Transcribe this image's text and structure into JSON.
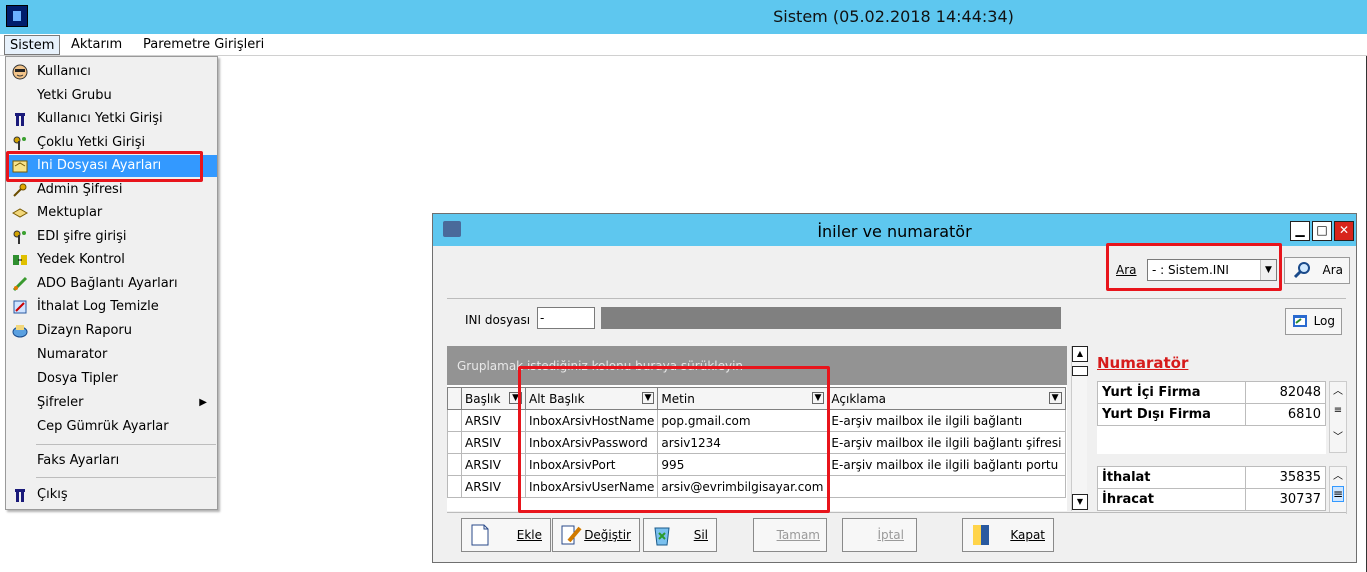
{
  "app": {
    "title": "Sistem (05.02.2018 14:44:34)"
  },
  "menubar": {
    "items": [
      "Sistem",
      "Aktarım",
      "Paremetre Girişleri"
    ]
  },
  "sistem_menu": {
    "items": [
      {
        "label": "Kullanıcı",
        "icon": "user-face-icon"
      },
      {
        "label": "Yetki Grubu",
        "icon": ""
      },
      {
        "label": "Kullanıcı Yetki Girişi",
        "icon": "user-key-icon"
      },
      {
        "label": "Çoklu Yetki Girişi",
        "icon": "keys-icon"
      },
      {
        "label": "Ini Dosyası  Ayarları",
        "icon": "settings-file-icon",
        "selected": true
      },
      {
        "label": "Admin Şifresi",
        "icon": "key-icon"
      },
      {
        "label": "Mektuplar",
        "icon": "envelope-icon"
      },
      {
        "label": "EDI şifre girişi",
        "icon": "keys-icon"
      },
      {
        "label": "Yedek Kontrol",
        "icon": "backup-icon"
      },
      {
        "label": "ADO Bağlantı Ayarları",
        "icon": "connection-icon"
      },
      {
        "label": "İthalat Log Temizle",
        "icon": "cleanup-icon"
      },
      {
        "label": "Dizayn Raporu",
        "icon": "report-icon"
      },
      {
        "label": "Numarator",
        "icon": ""
      },
      {
        "label": "Dosya Tipler",
        "icon": ""
      },
      {
        "label": "Şifreler",
        "icon": "",
        "submenu": true
      },
      {
        "label": "Cep Gümrük Ayarlar",
        "icon": ""
      },
      {
        "label": "Faks Ayarları",
        "icon": ""
      },
      {
        "label": "Çıkış",
        "icon": "exit-icon"
      }
    ]
  },
  "child_window": {
    "title": "İniler ve numaratör",
    "search": {
      "label": "Ara",
      "combo_value": "- : Sistem.INI",
      "button_label": "Ara"
    },
    "ini": {
      "label": "INI dosyası",
      "value": "-",
      "log_button": "Log"
    },
    "grid": {
      "group_hint": "Gruplamak istediğiniz kolonu buraya sürükleyin",
      "columns": [
        "Başlık",
        "Alt Başlık",
        "Metin",
        "Açıklama"
      ],
      "rows": [
        [
          "ARSIV",
          "InboxArsivHostName",
          "pop.gmail.com",
          "E-arşiv mailbox ile ilgili bağlantı"
        ],
        [
          "ARSIV",
          "InboxArsivPassword",
          "arsiv1234",
          "E-arşiv mailbox ile ilgili bağlantı şifresi"
        ],
        [
          "ARSIV",
          "InboxArsivPort",
          "995",
          "E-arşiv mailbox ile ilgili bağlantı portu"
        ],
        [
          "ARSIV",
          "InboxArsivUserName",
          "arsiv@evrimbilgisayar.com",
          ""
        ]
      ]
    },
    "numarator": {
      "title": "Numaratör",
      "rows_top": [
        {
          "label": "Yurt İçi Firma",
          "value": "82048"
        },
        {
          "label": "Yurt Dışı Firma",
          "value": "6810"
        }
      ],
      "rows_bottom": [
        {
          "label": "İthalat",
          "value": "35835"
        },
        {
          "label": "İhracat",
          "value": "30737"
        }
      ]
    },
    "toolbar": {
      "ekle": "Ekle",
      "degistir": "Değiştir",
      "sil": "Sil",
      "tamam": "Tamam",
      "iptal": "İptal",
      "kapat": "Kapat"
    }
  },
  "colors": {
    "titlebar": "#5ec7ef",
    "highlight": "#e8141b",
    "selection": "#3399ff"
  }
}
